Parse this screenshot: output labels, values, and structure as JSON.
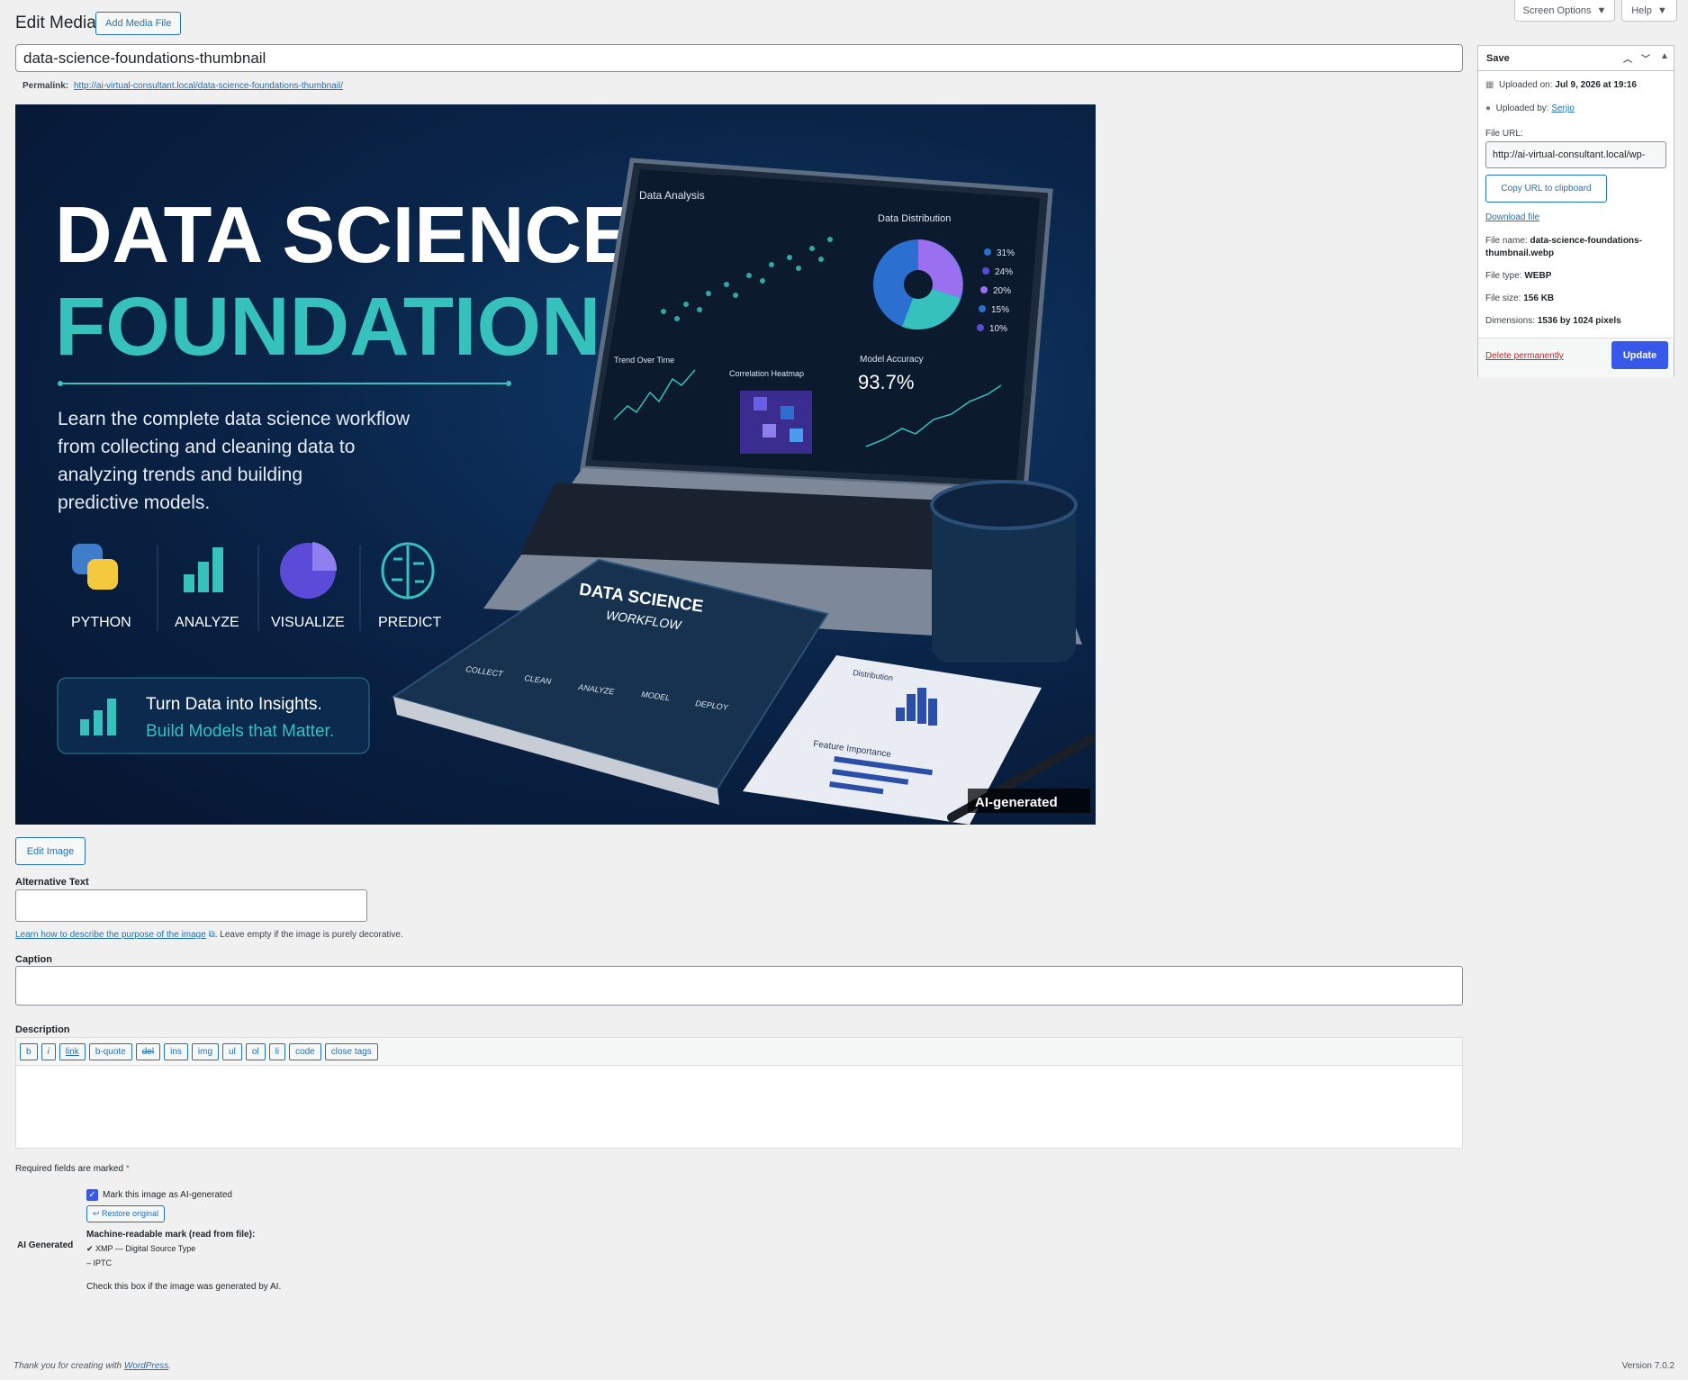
{
  "header": {
    "title": "Edit Media",
    "add_media_label": "Add Media File",
    "screen_options_label": "Screen Options",
    "help_label": "Help"
  },
  "post": {
    "title_value": "data-science-foundations-thumbnail",
    "permalink_label": "Permalink:",
    "permalink_url": "http://ai-virtual-consultant.local/data-science-foundations-thumbnail/"
  },
  "image": {
    "title_line1": "DATA SCIENCE",
    "title_line2": "FOUNDATIONS",
    "subtitle_lines": [
      "Learn the complete data science workflow",
      "from collecting and cleaning data to",
      "analyzing trends and building",
      "predictive models."
    ],
    "icons": [
      "PYTHON",
      "ANALYZE",
      "VISUALIZE",
      "PREDICT"
    ],
    "banner_line1": "Turn Data into Insights.",
    "banner_line2": "Build Models that Matter.",
    "screen_data_analysis": "Data Analysis",
    "screen_data_distribution": "Data Distribution",
    "screen_trend": "Trend Over Time",
    "screen_heatmap": "Correlation Heatmap",
    "screen_accuracy": "Model Accuracy",
    "accuracy_value": "93.7%",
    "pie_legend": [
      "31%",
      "24%",
      "20%",
      "15%",
      "10%"
    ],
    "book_title1": "DATA SCIENCE",
    "book_title2": "WORKFLOW",
    "book_steps": [
      "COLLECT",
      "CLEAN",
      "ANALYZE",
      "MODEL",
      "DEPLOY"
    ],
    "paper_distribution": "Distribution",
    "paper_feature": "Feature Importance",
    "ai_badge": "AI-generated"
  },
  "actions": {
    "edit_image_label": "Edit Image"
  },
  "fields": {
    "alt_label": "Alternative Text",
    "alt_help_link": "Learn how to describe the purpose of the image",
    "alt_help_rest": ". Leave empty if the image is purely decorative.",
    "caption_label": "Caption",
    "description_label": "Description",
    "quicktags": [
      "b",
      "i",
      "link",
      "b-quote",
      "del",
      "ins",
      "img",
      "ul",
      "ol",
      "li",
      "code",
      "close tags"
    ],
    "required_note": "Required fields are marked",
    "required_star": "*"
  },
  "ai": {
    "section_label": "AI Generated",
    "checkbox_label": "Mark this image as AI-generated",
    "restore_label": "↩ Restore original",
    "machine_mark_heading": "Machine-readable mark (read from file):",
    "xmp_line": "✔ XMP — Digital Source Type",
    "iptc_line": "– IPTC",
    "help_text": "Check this box if the image was generated by AI."
  },
  "sidebar": {
    "box_title": "Save",
    "uploaded_on_label": "Uploaded on:",
    "uploaded_on_value": "Jul 9, 2026 at 19:16",
    "uploaded_by_label": "Uploaded by:",
    "uploaded_by_value": "Serjio",
    "file_url_label": "File URL:",
    "file_url_value": "http://ai-virtual-consultant.local/wp-",
    "copy_url_label": "Copy URL to clipboard",
    "download_label": "Download file",
    "file_name_label": "File name:",
    "file_name_value_1": "data-science-foundations-",
    "file_name_value_2": "thumbnail.webp",
    "file_type_label": "File type:",
    "file_type_value": "WEBP",
    "file_size_label": "File size:",
    "file_size_value": "156 KB",
    "dimensions_label": "Dimensions:",
    "dimensions_value": "1536 by 1024 pixels",
    "delete_label": "Delete permanently",
    "update_label": "Update"
  },
  "footer": {
    "thanks_prefix": "Thank you for creating with",
    "wordpress_link": "WordPress",
    "thanks_suffix": ".",
    "version": "Version 7.0.2"
  },
  "colors": {
    "accent": "#3858e9",
    "link": "#2271b1",
    "delete": "#b32d2e",
    "image_teal": "#36c1bd"
  }
}
